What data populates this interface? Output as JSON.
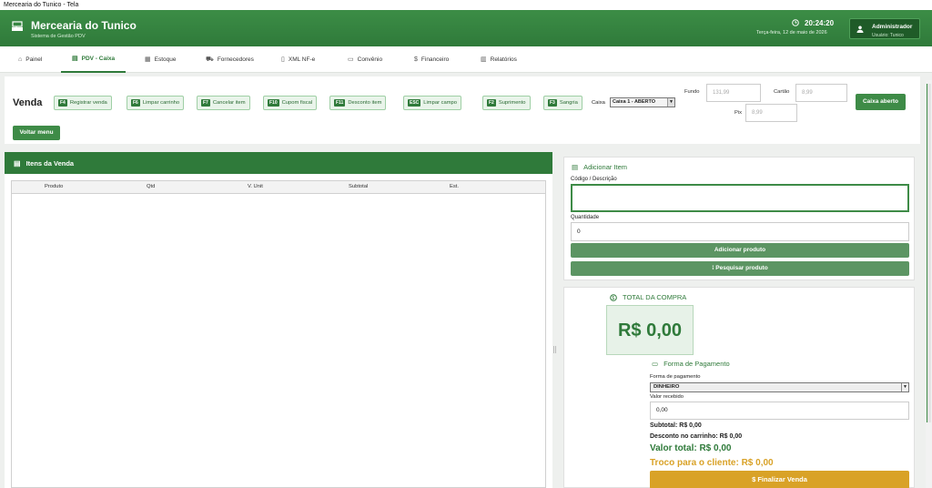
{
  "window": {
    "title": "Mercearia do Tunico - Tela"
  },
  "header": {
    "title": "Mercearia do Tunico",
    "subtitle": "Sistema de Gestão PDV",
    "clock": "20:24:20",
    "date": "Terça-feira, 12 de maio de 2026",
    "user_name": "Administrador",
    "user_role": "Usuário: Tunico",
    "colors": {
      "primary": "#2f7a3a",
      "accent": "#d9a227"
    }
  },
  "tabs": [
    {
      "label": "Painel",
      "icon": "dashboard-icon"
    },
    {
      "label": "PDV - Caixa",
      "icon": "register-icon",
      "active": true
    },
    {
      "label": "Estoque",
      "icon": "box-icon"
    },
    {
      "label": "Fornecedores",
      "icon": "truck-icon"
    },
    {
      "label": "XML NF-e",
      "icon": "document-icon"
    },
    {
      "label": "Convênio",
      "icon": "card-icon"
    },
    {
      "label": "Financeiro",
      "icon": "money-icon"
    },
    {
      "label": "Relatórios",
      "icon": "chart-icon"
    }
  ],
  "toolbar": {
    "title": "Venda",
    "buttons": [
      {
        "key": "F4",
        "label": "Registrar venda"
      },
      {
        "key": "F6",
        "label": "Limpar carrinho"
      },
      {
        "key": "F7",
        "label": "Cancelar item"
      },
      {
        "key": "F10",
        "label": "Cupom fiscal"
      },
      {
        "key": "F11",
        "label": "Desconto item"
      },
      {
        "key": "ESC",
        "label": "Limpar campo"
      },
      {
        "key": "F2",
        "label": "Suprimento"
      },
      {
        "key": "F3",
        "label": "Sangria"
      }
    ],
    "caixa_label": "Caixa",
    "caixa_selected": "Caixa 1 - ABERTO",
    "fundo_label": "Fundo",
    "fundo_value": "131,99",
    "cartao_label": "Cartão",
    "cartao_value": "8,99",
    "pix_label": "Pix",
    "pix_value": "8,99",
    "caixa_aberto": "Caixa aberto",
    "voltar": "Voltar menu"
  },
  "items": {
    "title": "Itens da Venda",
    "columns": [
      "Produto",
      "Qtd",
      "V. Unit",
      "Subtotal",
      "Est."
    ],
    "rows": []
  },
  "add_item": {
    "title": "Adicionar Item",
    "code_label": "Código / Descrição",
    "code_value": "",
    "qty_label": "Quantidade",
    "qty_value": "0",
    "add_button": "Adicionar produto",
    "search_button": "Pesquisar produto"
  },
  "total": {
    "title": "TOTAL DA COMPRA",
    "value": "R$ 0,00",
    "payment_title": "Forma de Pagamento",
    "payment_label": "Forma de pagamento",
    "payment_selected": "DINHEIRO",
    "received_label": "Valor recebido",
    "received_value": "0,00",
    "subtotal": "Subtotal: R$ 0,00",
    "discount": "Desconto no carrinho: R$ 0,00",
    "valor_total": "Valor total: R$ 0,00",
    "troco": "Troco para o cliente: R$ 0,00",
    "finalize": "Finalizar Venda"
  }
}
